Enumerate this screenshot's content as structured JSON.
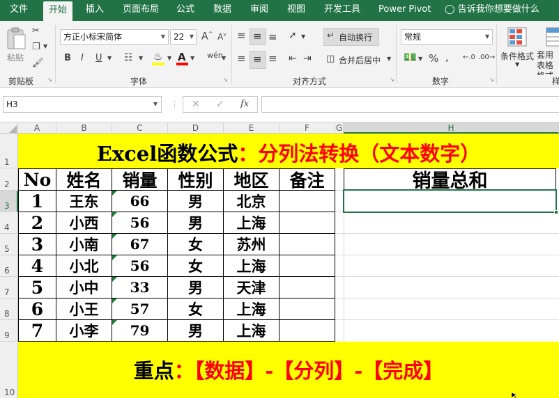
{
  "menu": [
    "文件",
    "开始",
    "插入",
    "页面布局",
    "公式",
    "数据",
    "审阅",
    "视图",
    "开发工具",
    "Power Pivot"
  ],
  "tell_me": "告诉我你想要做什么",
  "ribbon": {
    "paste": "粘贴",
    "clipboard": "剪贴板",
    "font_name": "方正小标宋简体",
    "font_size": "22",
    "font_group": "字体",
    "bold": "B",
    "italic": "I",
    "underline": "U",
    "wrap_text": "自动换行",
    "merge_center": "合并后居中",
    "align_group": "对齐方式",
    "number_format": "常规",
    "number_group": "数字",
    "conditional_format": "条件格式",
    "table_format": "套用\n表格格式",
    "styles_group_partial": "样"
  },
  "formula_bar": {
    "name_box": "H3",
    "fx": "fx",
    "formula": ""
  },
  "columns": [
    "A",
    "B",
    "C",
    "D",
    "E",
    "F",
    "G",
    "H"
  ],
  "rows": [
    "1",
    "2",
    "3",
    "4",
    "5",
    "6",
    "7",
    "8",
    "9",
    "10"
  ],
  "sheet": {
    "title_part1": "Excel函数公式",
    "title_colon": "：",
    "title_part2": "分列法转换（文本数字）",
    "headers": [
      "No",
      "姓名",
      "销量",
      "性别",
      "地区",
      "备注"
    ],
    "data": [
      [
        "1",
        "王东",
        "66",
        "男",
        "北京",
        ""
      ],
      [
        "2",
        "小西",
        "56",
        "男",
        "上海",
        ""
      ],
      [
        "3",
        "小南",
        "67",
        "女",
        "苏州",
        ""
      ],
      [
        "4",
        "小北",
        "56",
        "女",
        "上海",
        ""
      ],
      [
        "5",
        "小中",
        "33",
        "男",
        "天津",
        ""
      ],
      [
        "6",
        "小王",
        "57",
        "女",
        "上海",
        ""
      ],
      [
        "7",
        "小李",
        "79",
        "男",
        "上海",
        ""
      ]
    ],
    "sum_label": "销量总和",
    "sum_value": "",
    "footer_part1": "重点",
    "footer_colon": "：",
    "footer_part2": "【数据】-【分列】-【完成】"
  },
  "colors": {
    "excel_green": "#217346",
    "highlight_yellow": "#ffff00",
    "title_red": "#ff0000",
    "text_number_triangle": "#1e7d3a"
  }
}
